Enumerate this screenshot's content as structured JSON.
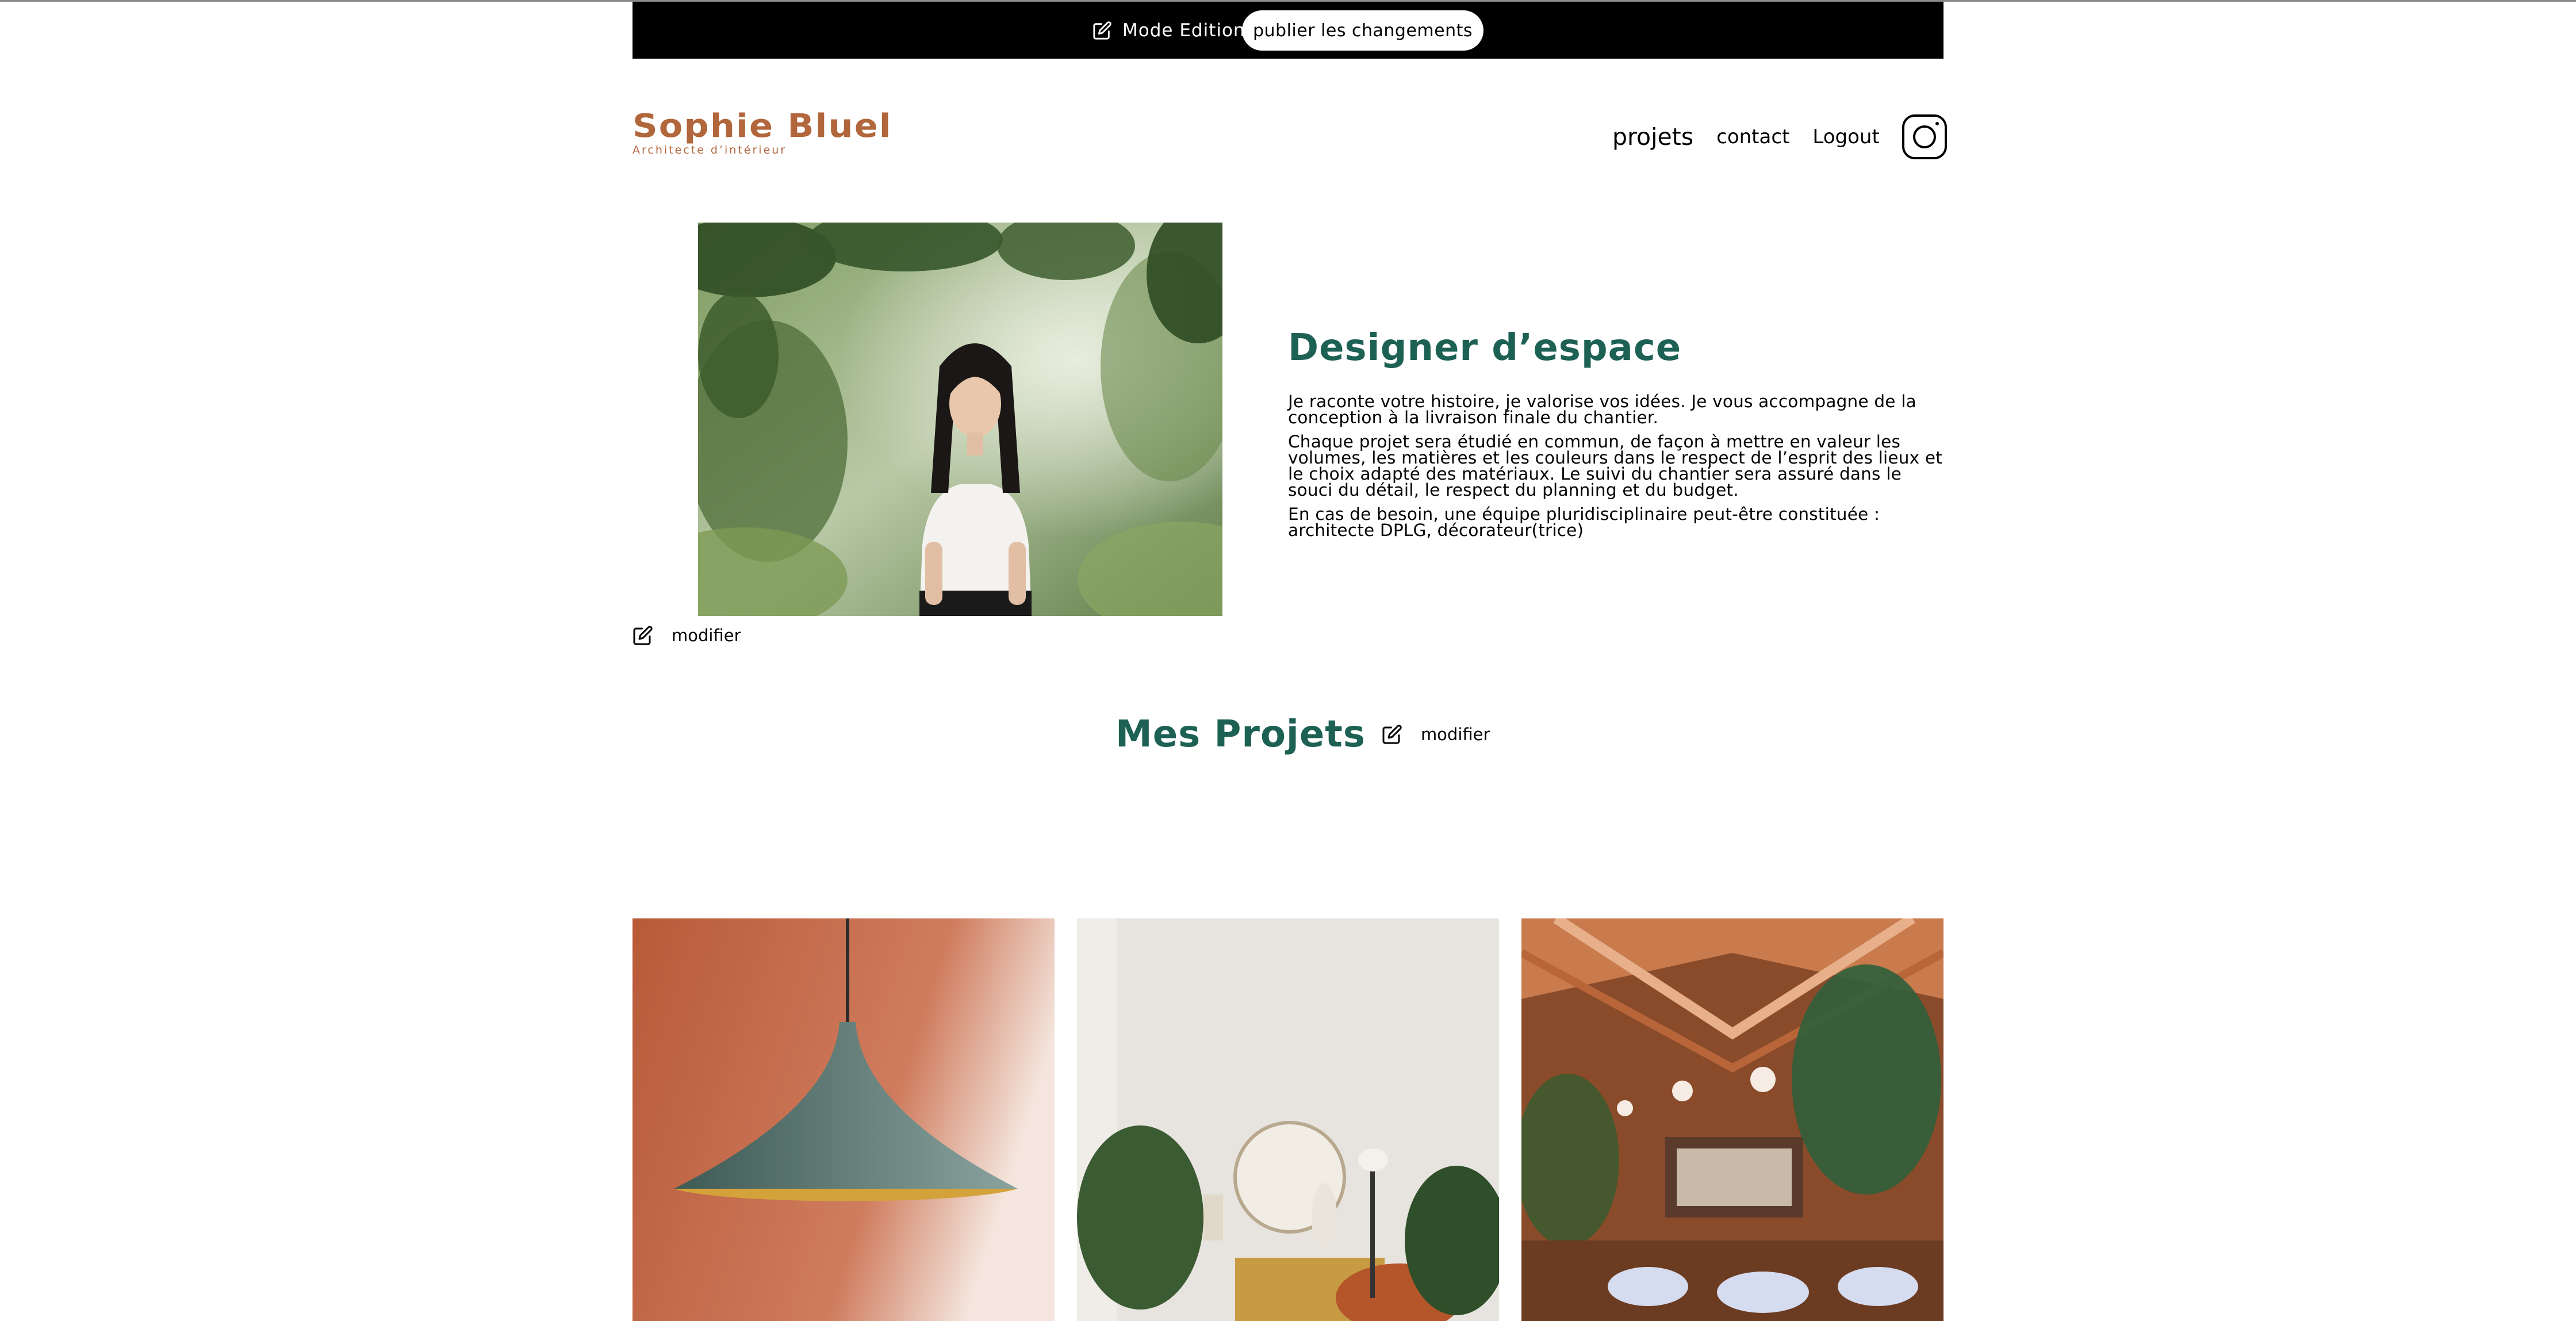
{
  "edit_bar": {
    "mode_label": "Mode Edition",
    "publish_label": "publier les changements"
  },
  "header": {
    "logo_name": "Sophie Bluel",
    "logo_subtitle": "Architecte d’intérieur",
    "nav": {
      "projets": "projets",
      "contact": "contact",
      "logout": "Logout"
    },
    "instagram_icon": "instagram-icon"
  },
  "intro": {
    "modify_label": "modifier",
    "title": "Designer d’espace",
    "paragraphs": [
      "Je raconte votre histoire, je valorise vos idées. Je vous accompagne de la conception à la livraison finale du chantier.",
      "Chaque projet sera étudié en commun, de façon à mettre en valeur les volumes, les matières et les couleurs dans le respect de l’esprit des lieux et le choix adapté des matériaux. Le suivi du chantier sera assuré dans le souci du détail, le respect du planning et du budget.",
      "En cas de besoin, une équipe pluridisciplinaire peut-être constituée : architecte DPLG, décorateur(trice)"
    ]
  },
  "projects": {
    "title": "Mes Projets",
    "modify_label": "modifier"
  },
  "colors": {
    "brand": "#B1663C",
    "accent": "#1D6154",
    "bar": "#000000"
  }
}
